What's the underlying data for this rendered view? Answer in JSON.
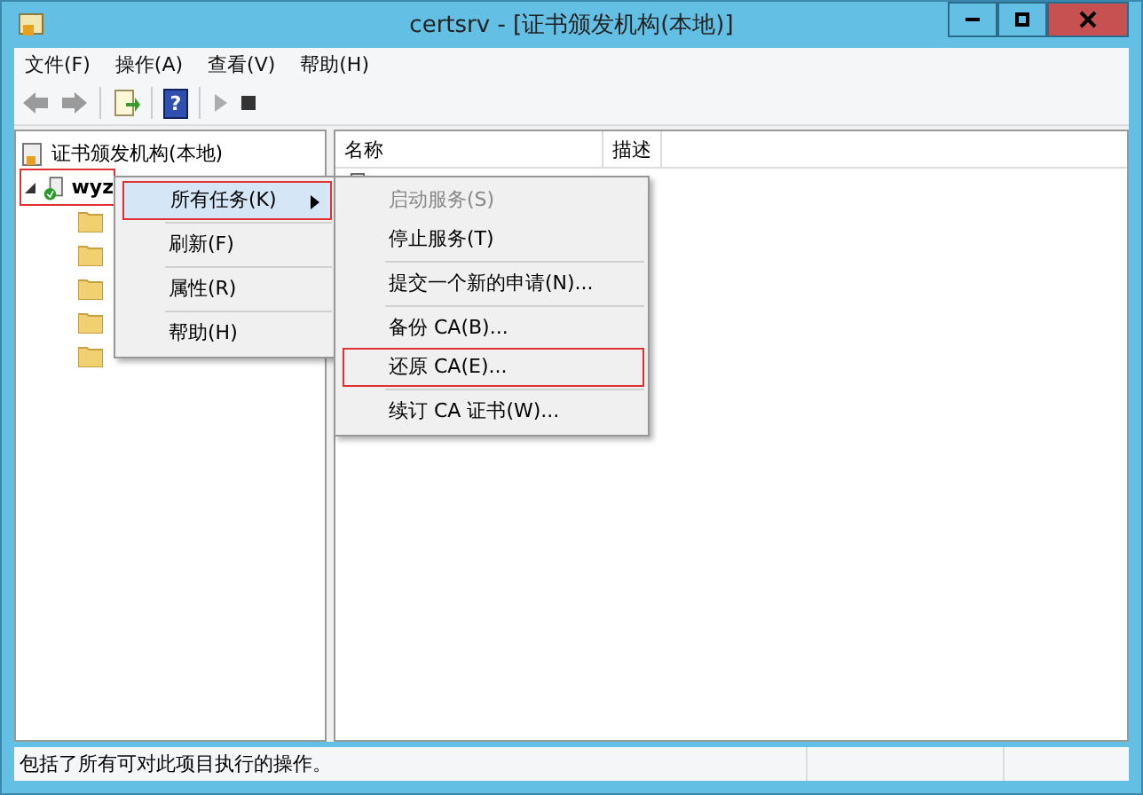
{
  "window": {
    "title": "certsrv - [证书颁发机构(本地)]"
  },
  "menu_bar": [
    {
      "label": "文件(F)"
    },
    {
      "label": "操作(A)"
    },
    {
      "label": "查看(V)"
    },
    {
      "label": "帮助(H)"
    }
  ],
  "toolbar": [
    {
      "kind": "back",
      "disabled": false
    },
    {
      "kind": "forward",
      "disabled": false
    },
    {
      "kind": "sep"
    },
    {
      "kind": "export",
      "disabled": false
    },
    {
      "kind": "sep"
    },
    {
      "kind": "help",
      "label": "?",
      "disabled": false
    },
    {
      "kind": "sep"
    },
    {
      "kind": "play",
      "disabled": true
    },
    {
      "kind": "stop",
      "disabled": false
    }
  ],
  "tree": {
    "label": "证书颁发机构(本地)",
    "children": [
      {
        "label": "wyz",
        "expanded": true,
        "highlighted": true,
        "children": [
          {
            "kind": "folder"
          },
          {
            "kind": "folder"
          },
          {
            "kind": "folder"
          },
          {
            "kind": "folder"
          },
          {
            "kind": "folder"
          }
        ]
      }
    ]
  },
  "list": {
    "columns": [
      "名称",
      "描述"
    ]
  },
  "context_menu": [
    {
      "label": "所有任务(K)",
      "selected": true,
      "highlighted": true,
      "submenu": true
    },
    {
      "label": "刷新(F)",
      "selected": false,
      "highlighted": false,
      "submenu": false
    },
    {
      "label": "属性(R)",
      "selected": false,
      "highlighted": false,
      "submenu": false
    },
    {
      "label": "帮助(H)",
      "selected": false,
      "highlighted": false,
      "submenu": false
    }
  ],
  "submenu": [
    {
      "label": "启动服务(S)",
      "disabled": true,
      "highlighted": false,
      "separator_before": false
    },
    {
      "label": "停止服务(T)",
      "disabled": false,
      "highlighted": false,
      "separator_before": false
    },
    {
      "label": "提交一个新的申请(N)...",
      "disabled": false,
      "highlighted": false,
      "separator_before": true
    },
    {
      "label": "备份 CA(B)...",
      "disabled": false,
      "highlighted": false,
      "separator_before": true
    },
    {
      "label": "还原 CA(E)...",
      "disabled": false,
      "highlighted": true,
      "separator_before": false
    },
    {
      "label": "续订 CA 证书(W)...",
      "disabled": false,
      "highlighted": false,
      "separator_before": true
    }
  ],
  "status_bar": {
    "text": "包括了所有可对此项目执行的操作。"
  }
}
